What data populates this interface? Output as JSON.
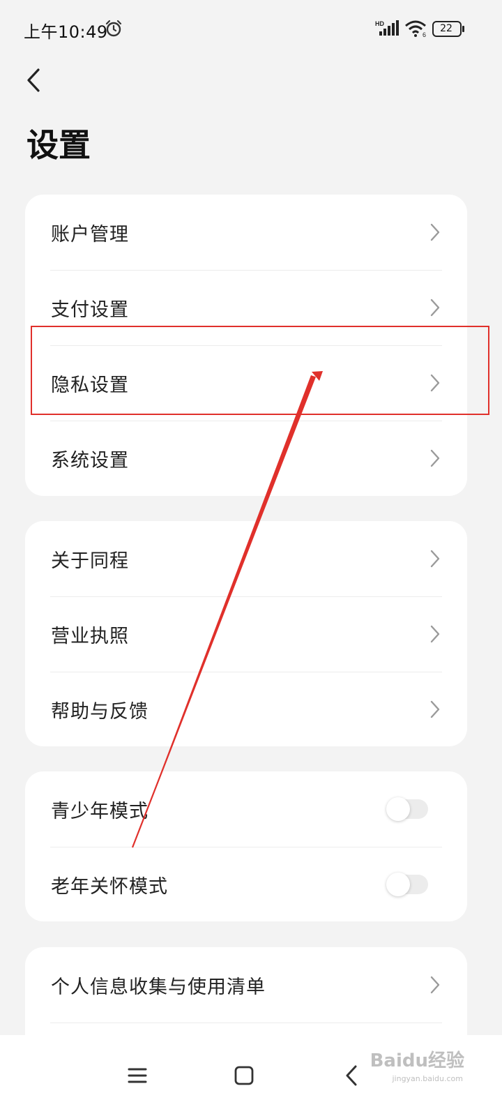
{
  "status_bar": {
    "time": "上午10:49",
    "battery": "22",
    "network_label": "HD"
  },
  "header": {
    "title": "设置"
  },
  "groups": [
    {
      "items": [
        {
          "label": "账户管理"
        },
        {
          "label": "支付设置"
        },
        {
          "label": "隐私设置"
        },
        {
          "label": "系统设置"
        }
      ]
    },
    {
      "items": [
        {
          "label": "关于同程"
        },
        {
          "label": "营业执照"
        },
        {
          "label": "帮助与反馈"
        }
      ]
    },
    {
      "items": [
        {
          "label": "青少年模式",
          "toggle": false
        },
        {
          "label": "老年关怀模式",
          "toggle": false
        }
      ]
    },
    {
      "items": [
        {
          "label": "个人信息收集与使用清单"
        }
      ]
    }
  ],
  "annotation": {
    "highlight_color": "#e0302b"
  },
  "watermark": {
    "text": "Baidu经验",
    "sub": "jingyan.baidu.com"
  }
}
